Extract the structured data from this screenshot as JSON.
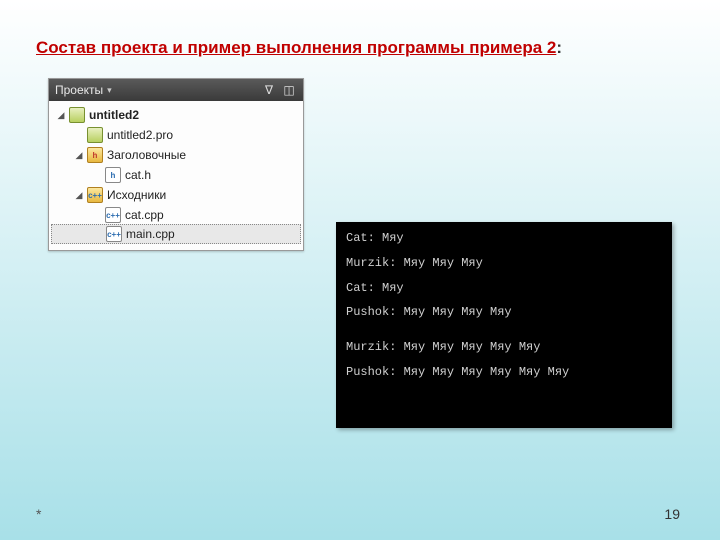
{
  "title": "Состав проекта и пример выполнения программы примера 2",
  "title_colon": ":",
  "panel": {
    "header_label": "Проекты",
    "filter_icon": "∇",
    "split_icon": "◫"
  },
  "tree": {
    "project": {
      "label": "untitled2",
      "icon_text": ""
    },
    "pro_file": {
      "label": "untitled2.pro",
      "icon_text": ""
    },
    "headers_folder": {
      "label": "Заголовочные",
      "icon_text": "h"
    },
    "cat_h": {
      "label": "cat.h",
      "icon_text": "h"
    },
    "sources_folder": {
      "label": "Исходники",
      "icon_text": "c++"
    },
    "cat_cpp": {
      "label": "cat.cpp",
      "icon_text": "c++"
    },
    "main_cpp": {
      "label": "main.cpp",
      "icon_text": "c++"
    }
  },
  "console": {
    "lines": [
      "Cat: Мяу",
      "Murzik: Мяу Мяу Мяу",
      "Cat: Мяу",
      "Pushok: Мяу Мяу Мяу Мяу",
      "",
      "Murzik: Мяу Мяу Мяу Мяу Мяу",
      "Pushok: Мяу Мяу Мяу Мяу Мяу Мяу"
    ]
  },
  "footnote": "*",
  "page_number": "19"
}
